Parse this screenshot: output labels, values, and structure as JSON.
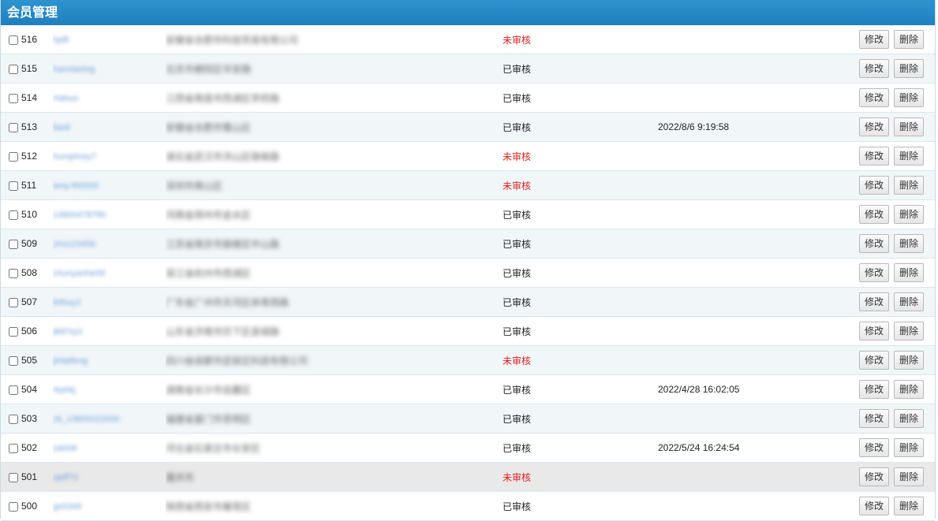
{
  "header": {
    "title": "会员管理"
  },
  "actions": {
    "edit_label": "修改",
    "delete_label": "删除"
  },
  "colors": {
    "unreviewed": "#e02020",
    "header_bg": "#2a8bcb"
  },
  "rows": [
    {
      "id": "516",
      "user": "hjdfi",
      "address": "安徽省合肥市科技贸易有限公司",
      "status": "未审核",
      "status_type": "no",
      "time": ""
    },
    {
      "id": "515",
      "user": "hanxiaolog",
      "address": "北京市朝阳区华安路",
      "status": "已审核",
      "status_type": "yes",
      "time": ""
    },
    {
      "id": "514",
      "user": "Hahuo",
      "address": "江西省南昌市西湖区学府路",
      "status": "已审核",
      "status_type": "yes",
      "time": ""
    },
    {
      "id": "513",
      "user": "liaoli",
      "address": "安徽省合肥市蜀山区",
      "status": "已审核",
      "status_type": "yes",
      "time": "2022/8/6 9:19:58"
    },
    {
      "id": "512",
      "user": "humphrey7",
      "address": "湖北省武汉市洪山区珞喻路",
      "status": "未审核",
      "status_type": "no",
      "time": ""
    },
    {
      "id": "511",
      "user": "amy-f00000",
      "address": "深圳市南山区",
      "status": "未审核",
      "status_type": "no",
      "time": ""
    },
    {
      "id": "510",
      "user": "13800478790",
      "address": "河南省郑州市金水区",
      "status": "已审核",
      "status_type": "yes",
      "time": ""
    },
    {
      "id": "509",
      "user": "zhs123456",
      "address": "江苏省南京市鼓楼区中山路",
      "status": "已审核",
      "status_type": "yes",
      "time": ""
    },
    {
      "id": "508",
      "user": "chunyanhe09",
      "address": "浙江省杭州市西湖区",
      "status": "已审核",
      "status_type": "yes",
      "time": ""
    },
    {
      "id": "507",
      "user": "lirthuy2",
      "address": "广东省广州市天河区体育西路",
      "status": "已审核",
      "status_type": "yes",
      "time": ""
    },
    {
      "id": "506",
      "user": "jiktl7q1t",
      "address": "山东省济南市历下区泉城路",
      "status": "已审核",
      "status_type": "yes",
      "time": ""
    },
    {
      "id": "505",
      "user": "jintaifeng",
      "address": "四川省成都市武侯区科技有限公司",
      "status": "未审核",
      "status_type": "no",
      "time": ""
    },
    {
      "id": "504",
      "user": "rkyhkj",
      "address": "湖南省长沙市岳麓区",
      "status": "已审核",
      "status_type": "yes",
      "time": "2022/4/28 16:02:05"
    },
    {
      "id": "503",
      "user": "clt_13800022000",
      "address": "福建省厦门市思明区",
      "status": "已审核",
      "status_type": "yes",
      "time": ""
    },
    {
      "id": "502",
      "user": "zdrt08",
      "address": "河北省石家庄市长安区",
      "status": "已审核",
      "status_type": "yes",
      "time": "2022/5/24 16:24:54"
    },
    {
      "id": "501",
      "user": "xjeff72",
      "address": "重庆市",
      "status": "未审核",
      "status_type": "no",
      "time": ""
    },
    {
      "id": "500",
      "user": "gs5349",
      "address": "陕西省西安市雁塔区",
      "status": "已审核",
      "status_type": "yes",
      "time": ""
    }
  ]
}
